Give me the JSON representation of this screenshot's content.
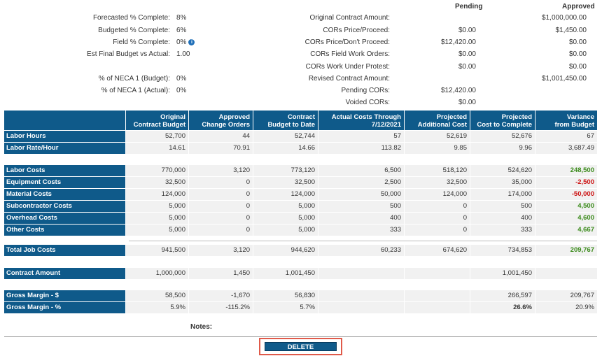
{
  "summary_left": [
    {
      "label": "Forecasted % Complete:",
      "value": "8%"
    },
    {
      "label": "Budgeted % Complete:",
      "value": "6%"
    },
    {
      "label": "Field % Complete:",
      "value": "0%"
    },
    {
      "label": "Est Final Budget vs Actual:",
      "value": "1.00"
    },
    {
      "label": "% of NECA 1 (Budget):",
      "value": "0%"
    },
    {
      "label": "% of NECA 1 (Actual):",
      "value": "0%"
    }
  ],
  "summary_right_headers": {
    "pending": "Pending",
    "approved": "Approved"
  },
  "summary_right": [
    {
      "label": "Original Contract Amount:",
      "pending": "",
      "approved": "$1,000,000.00"
    },
    {
      "label": "CORs Price/Proceed:",
      "pending": "$0.00",
      "approved": "$1,450.00"
    },
    {
      "label": "CORs Price/Don't Proceed:",
      "pending": "$12,420.00",
      "approved": "$0.00"
    },
    {
      "label": "CORs Field Work Orders:",
      "pending": "$0.00",
      "approved": "$0.00"
    },
    {
      "label": "CORs Work Under Protest:",
      "pending": "$0.00",
      "approved": "$0.00"
    },
    {
      "label": "Revised Contract Amount:",
      "pending": "",
      "approved": "$1,001,450.00"
    },
    {
      "label": "Pending CORs:",
      "pending": "$12,420.00",
      "approved": ""
    },
    {
      "label": "Voided CORs:",
      "pending": "$0.00",
      "approved": ""
    }
  ],
  "table": {
    "columns": [
      [
        "Original",
        "Contract Budget"
      ],
      [
        "Approved",
        "Change Orders"
      ],
      [
        "Contract",
        "Budget to Date"
      ],
      [
        "Actual Costs Through",
        "7/12/2021"
      ],
      [
        "Projected",
        "Additional Cost"
      ],
      [
        "Projected",
        "Cost to Complete"
      ],
      [
        "Variance",
        "from Budget"
      ]
    ],
    "rows": {
      "labor_hours": {
        "label": "Labor Hours",
        "cells": [
          "52,700",
          "44",
          "52,744",
          "57",
          "52,619",
          "52,676",
          "67"
        ]
      },
      "labor_rate": {
        "label": "Labor Rate/Hour",
        "cells": [
          "14.61",
          "70.91",
          "14.66",
          "113.82",
          "9.85",
          "9.96",
          "3,687.49"
        ]
      },
      "labor_costs": {
        "label": "Labor Costs",
        "cells": [
          "770,000",
          "3,120",
          "773,120",
          "6,500",
          "518,120",
          "524,620",
          "248,500"
        ]
      },
      "equipment_costs": {
        "label": "Equipment Costs",
        "cells": [
          "32,500",
          "0",
          "32,500",
          "2,500",
          "32,500",
          "35,000",
          "-2,500"
        ]
      },
      "material_costs": {
        "label": "Material Costs",
        "cells": [
          "124,000",
          "0",
          "124,000",
          "50,000",
          "124,000",
          "174,000",
          "-50,000"
        ]
      },
      "subcontractor_costs": {
        "label": "Subcontractor Costs",
        "cells": [
          "5,000",
          "0",
          "5,000",
          "500",
          "0",
          "500",
          "4,500"
        ]
      },
      "overhead_costs": {
        "label": "Overhead Costs",
        "cells": [
          "5,000",
          "0",
          "5,000",
          "400",
          "0",
          "400",
          "4,600"
        ]
      },
      "other_costs": {
        "label": "Other Costs",
        "cells": [
          "5,000",
          "0",
          "5,000",
          "333",
          "0",
          "333",
          "4,667"
        ]
      },
      "total_job_costs": {
        "label": "Total Job Costs",
        "cells": [
          "941,500",
          "3,120",
          "944,620",
          "60,233",
          "674,620",
          "734,853",
          "209,767"
        ]
      },
      "contract_amount": {
        "label": "Contract Amount",
        "cells": [
          "1,000,000",
          "1,450",
          "1,001,450",
          "",
          "",
          "1,001,450",
          ""
        ]
      },
      "gross_margin_dollar": {
        "label": "Gross Margin - $",
        "cells": [
          "58,500",
          "-1,670",
          "56,830",
          "",
          "",
          "266,597",
          "209,767"
        ]
      },
      "gross_margin_pct": {
        "label": "Gross Margin - %",
        "cells": [
          "5.9%",
          "-115.2%",
          "5.7%",
          "",
          "",
          "26.6%",
          "20.9%"
        ]
      }
    }
  },
  "notes_label": "Notes:",
  "delete_label": "DELETE",
  "colors": {
    "header_bg": "#0f5a8a",
    "positive": "#3a8a1a",
    "negative": "#cc1111",
    "highlight_border": "#e05a4a"
  }
}
